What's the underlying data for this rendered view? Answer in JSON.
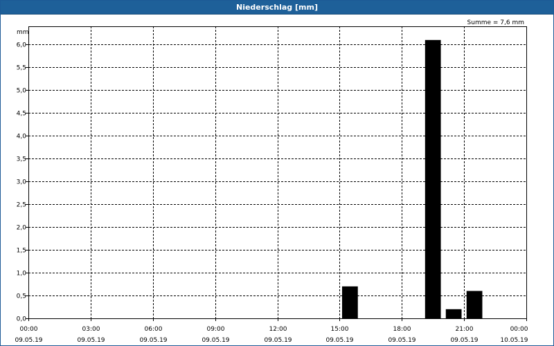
{
  "window": {
    "title": "Niederschlag [mm]"
  },
  "chart_data": {
    "type": "bar",
    "title": "Niederschlag [mm]",
    "ylabel": "mm",
    "xlabel": "",
    "annotation": "Summe = 7,6 mm",
    "ylim": [
      0,
      6.4
    ],
    "yticks": [
      "0,0",
      "0,5",
      "1,0",
      "1,5",
      "2,0",
      "2,5",
      "3,0",
      "3,5",
      "4,0",
      "4,5",
      "5,0",
      "5,5",
      "6,0"
    ],
    "xticks": [
      {
        "time": "00:00",
        "date": "09.05.19"
      },
      {
        "time": "03:00",
        "date": "09.05.19"
      },
      {
        "time": "06:00",
        "date": "09.05.19"
      },
      {
        "time": "09:00",
        "date": "09.05.19"
      },
      {
        "time": "12:00",
        "date": "09.05.19"
      },
      {
        "time": "15:00",
        "date": "09.05.19"
      },
      {
        "time": "18:00",
        "date": "09.05.19"
      },
      {
        "time": "21:00",
        "date": "09.05.19"
      },
      {
        "time": "00:00",
        "date": "10.05.19"
      }
    ],
    "x_range": [
      "09.05.19 00:00",
      "10.05.19 00:00"
    ],
    "grid": true,
    "bar_color": "#000000",
    "bars": [
      {
        "time": "09.05.19 15:00",
        "value": 0.7
      },
      {
        "time": "09.05.19 19:00",
        "value": 6.1
      },
      {
        "time": "09.05.19 20:00",
        "value": 0.2
      },
      {
        "time": "09.05.19 21:00",
        "value": 0.6
      }
    ]
  }
}
